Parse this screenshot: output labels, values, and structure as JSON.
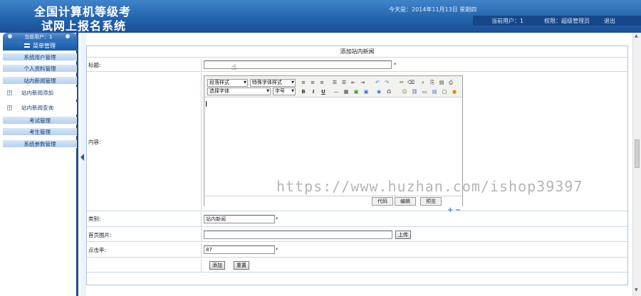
{
  "header": {
    "title_line1": "全国计算机等级考",
    "title_line2": "试网上报名系统",
    "date": "今天是：2014年11月13日 星期四",
    "current_user": "当前用户：1",
    "role": "权限：超级管理员",
    "logout": "退出"
  },
  "sidebar": {
    "top_label": "当前用户：1",
    "menu_title": "菜单管理",
    "items": [
      {
        "label": "系统用户管理"
      },
      {
        "label": "个人资料管理"
      },
      {
        "label": "站内新闻管理"
      }
    ],
    "subitems": [
      {
        "label": "站内新闻添加"
      },
      {
        "label": "站内新闻查询"
      }
    ],
    "items2": [
      {
        "label": "考试管理"
      },
      {
        "label": "考生管理"
      },
      {
        "label": "系统参数管理"
      }
    ]
  },
  "form": {
    "title": "添加站内新闻",
    "title_label": "标题:",
    "title_value": "",
    "required_mark": "*",
    "content_label": "内容:",
    "category_label": "类别:",
    "category_value": "站内新闻",
    "image_label": "首页图片:",
    "image_value": "",
    "upload_button": "上传",
    "clicks_label": "点击率:",
    "clicks_value": "87",
    "add_button": "添加",
    "reset_button": "重置"
  },
  "editor": {
    "paragraph_select": "段落样式",
    "special_select": "特殊字体样式",
    "font_select": "选择字体",
    "size_select": "字号",
    "tabs": [
      "代码",
      "编辑",
      "预览"
    ],
    "bold": "B",
    "italic": "I",
    "underline": "U"
  },
  "watermark": "https://www.huzhan.com/ishop39397"
}
